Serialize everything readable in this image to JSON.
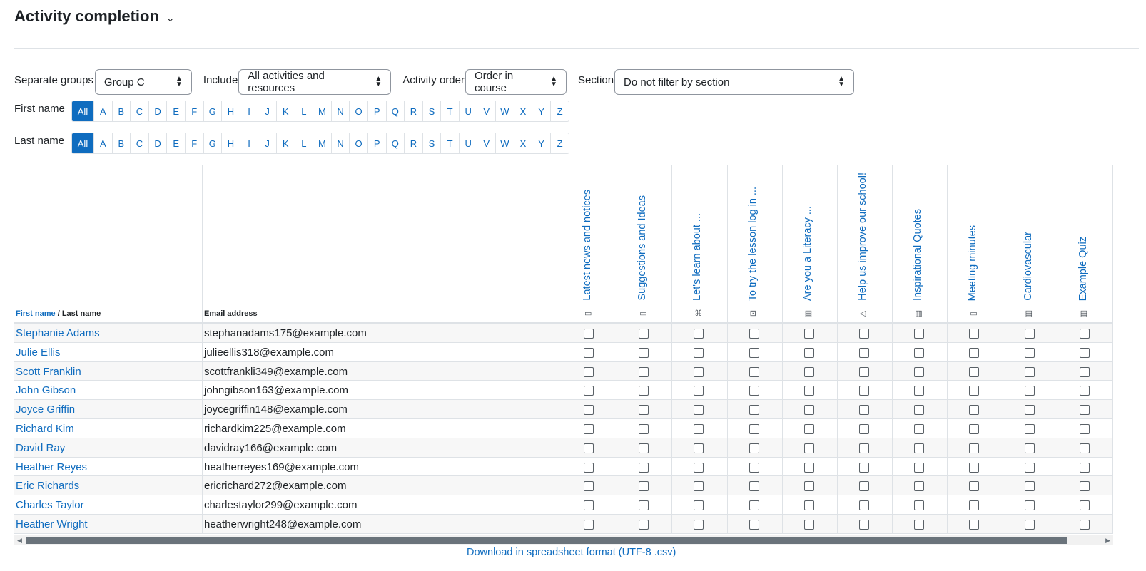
{
  "page": {
    "title": "Activity completion",
    "title_chevron": "⌄"
  },
  "filters": {
    "groups_label": "Separate groups",
    "groups_value": "Group C",
    "include_label": "Include",
    "include_value": "All activities and resources",
    "order_label": "Activity order",
    "order_value": "Order in course",
    "section_label": "Section",
    "section_value": "Do not filter by section"
  },
  "initials": {
    "first_label": "First name",
    "last_label": "Last name",
    "all_label": "All",
    "letters": [
      "A",
      "B",
      "C",
      "D",
      "E",
      "F",
      "G",
      "H",
      "I",
      "J",
      "K",
      "L",
      "M",
      "N",
      "O",
      "P",
      "Q",
      "R",
      "S",
      "T",
      "U",
      "V",
      "W",
      "X",
      "Y",
      "Z"
    ]
  },
  "table": {
    "header_first": "First name",
    "header_sep": " / ",
    "header_last": "Last name",
    "header_email": "Email address",
    "activities": [
      {
        "name": "Latest news and notices",
        "icon": "forum-icon",
        "glyph": "▭"
      },
      {
        "name": "Suggestions and Ideas",
        "icon": "forum-icon",
        "glyph": "▭"
      },
      {
        "name": "Let's learn about ...",
        "icon": "h5p-icon",
        "glyph": "⌘"
      },
      {
        "name": "To try the lesson log in ...",
        "icon": "lesson-icon",
        "glyph": "⊡"
      },
      {
        "name": "Are you a Literacy ...",
        "icon": "page-icon",
        "glyph": "▤"
      },
      {
        "name": "Help us improve our school!",
        "icon": "feedback-icon",
        "glyph": "◁"
      },
      {
        "name": "Inspirational Quotes",
        "icon": "glossary-icon",
        "glyph": "▥"
      },
      {
        "name": "Meeting minutes",
        "icon": "forum-icon",
        "glyph": "▭"
      },
      {
        "name": "Cardiovascular",
        "icon": "page-icon",
        "glyph": "▤"
      },
      {
        "name": "Example Quiz",
        "icon": "page-icon",
        "glyph": "▤"
      }
    ],
    "users": [
      {
        "name": "Stephanie Adams",
        "email": "stephanadams175@example.com"
      },
      {
        "name": "Julie Ellis",
        "email": "julieellis318@example.com"
      },
      {
        "name": "Scott Franklin",
        "email": "scottfrankli349@example.com"
      },
      {
        "name": "John Gibson",
        "email": "johngibson163@example.com"
      },
      {
        "name": "Joyce Griffin",
        "email": "joycegriffin148@example.com"
      },
      {
        "name": "Richard Kim",
        "email": "richardkim225@example.com"
      },
      {
        "name": "David Ray",
        "email": "davidray166@example.com"
      },
      {
        "name": "Heather Reyes",
        "email": "heatherreyes169@example.com"
      },
      {
        "name": "Eric Richards",
        "email": "ericrichard272@example.com"
      },
      {
        "name": "Charles Taylor",
        "email": "charlestaylor299@example.com"
      },
      {
        "name": "Heather Wright",
        "email": "heatherwright248@example.com"
      }
    ]
  },
  "scroll": {
    "left_arrow": "◀",
    "right_arrow": "▶"
  },
  "download_label": "Download in spreadsheet format (UTF-8 .csv)"
}
